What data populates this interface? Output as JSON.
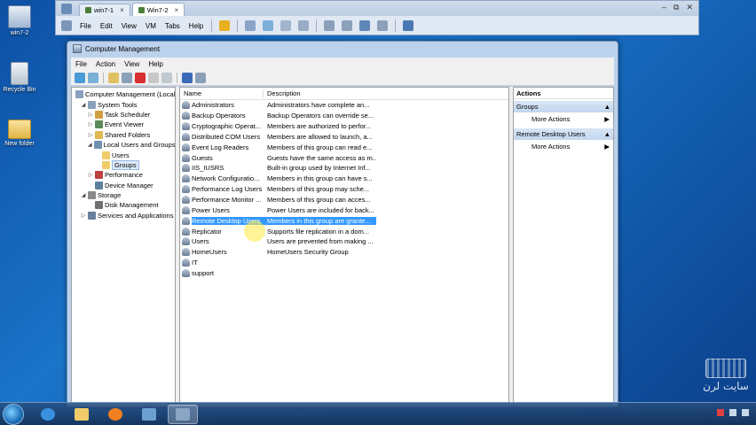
{
  "desktop": {
    "icons": [
      {
        "label": "win7-2",
        "icon": "virtualbox-vm-icon"
      },
      {
        "label": "Recycle Bin",
        "icon": "recycle-bin-icon"
      },
      {
        "label": "New folder",
        "icon": "folder-icon"
      }
    ]
  },
  "vbox": {
    "tabs": [
      {
        "label": "win7-1",
        "active": false
      },
      {
        "label": "Win7-2",
        "active": true
      }
    ],
    "close_glyph": "×",
    "window_buttons": [
      "–",
      "⧉",
      "✕"
    ],
    "menu": [
      "File",
      "Edit",
      "View",
      "VM",
      "Tabs",
      "Help"
    ]
  },
  "cm": {
    "title": "Computer Management",
    "menu": [
      "File",
      "Action",
      "View",
      "Help"
    ],
    "tree": [
      {
        "label": "Computer Management (Local",
        "level": 0,
        "arrow": "",
        "icon": "computer-icon",
        "color": "#8aa0bc"
      },
      {
        "label": "System Tools",
        "level": 1,
        "arrow": "◢",
        "icon": "tools-icon",
        "color": "#8aa0bc"
      },
      {
        "label": "Task Scheduler",
        "level": 2,
        "arrow": "▷",
        "icon": "clock-icon",
        "color": "#d0a040"
      },
      {
        "label": "Event Viewer",
        "level": 2,
        "arrow": "▷",
        "icon": "event-viewer-icon",
        "color": "#5a8a5a"
      },
      {
        "label": "Shared Folders",
        "level": 2,
        "arrow": "▷",
        "icon": "shared-folder-icon",
        "color": "#e0b850"
      },
      {
        "label": "Local Users and Groups",
        "level": 2,
        "arrow": "◢",
        "icon": "users-icon",
        "color": "#7090b0"
      },
      {
        "label": "Users",
        "level": 3,
        "arrow": "",
        "icon": "folder-icon",
        "color": "#f0cd6a"
      },
      {
        "label": "Groups",
        "level": 3,
        "arrow": "",
        "icon": "folder-icon",
        "color": "#f0cd6a",
        "selected": true
      },
      {
        "label": "Performance",
        "level": 2,
        "arrow": "▷",
        "icon": "performance-icon",
        "color": "#c04040"
      },
      {
        "label": "Device Manager",
        "level": 2,
        "arrow": "",
        "icon": "device-manager-icon",
        "color": "#6080a0"
      },
      {
        "label": "Storage",
        "level": 1,
        "arrow": "◢",
        "icon": "storage-icon",
        "color": "#8a8a8a"
      },
      {
        "label": "Disk Management",
        "level": 2,
        "arrow": "",
        "icon": "disk-icon",
        "color": "#707070"
      },
      {
        "label": "Services and Applications",
        "level": 1,
        "arrow": "▷",
        "icon": "services-icon",
        "color": "#6a7f9a"
      }
    ],
    "columns": {
      "name": "Name",
      "description": "Description"
    },
    "groups": [
      {
        "name": "Administrators",
        "description": "Administrators have complete an..."
      },
      {
        "name": "Backup Operators",
        "description": "Backup Operators can override se..."
      },
      {
        "name": "Cryptographic Operat...",
        "description": "Members are authorized to perfor..."
      },
      {
        "name": "Distributed COM Users",
        "description": "Members are allowed to launch, a..."
      },
      {
        "name": "Event Log Readers",
        "description": "Members of this group can read e..."
      },
      {
        "name": "Guests",
        "description": "Guests have the same access as m..."
      },
      {
        "name": "IIS_IUSRS",
        "description": "Built-in group used by Internet Inf..."
      },
      {
        "name": "Network Configuratio...",
        "description": "Members in this group can have s..."
      },
      {
        "name": "Performance Log Users",
        "description": "Members of this group may sche..."
      },
      {
        "name": "Performance Monitor ...",
        "description": "Members of this group can acces..."
      },
      {
        "name": "Power Users",
        "description": "Power Users are included for back..."
      },
      {
        "name": "Remote Desktop Users",
        "description": "Members in this group are grante...",
        "selected": true
      },
      {
        "name": "Replicator",
        "description": "Supports file replication in a dom..."
      },
      {
        "name": "Users",
        "description": "Users are prevented from making ..."
      },
      {
        "name": "HomeUsers",
        "description": "HomeUsers Security Group"
      },
      {
        "name": "IT",
        "description": ""
      },
      {
        "name": "support",
        "description": ""
      }
    ],
    "actions": {
      "header": "Actions",
      "sections": [
        {
          "title": "Groups",
          "items": [
            "More Actions"
          ]
        },
        {
          "title": "Remote Desktop Users",
          "items": [
            "More Actions"
          ]
        }
      ]
    }
  },
  "watermark": {
    "text": "سایت لرن"
  },
  "colors": {
    "selection": "#3399ff",
    "desktop": "#1a74c8"
  }
}
